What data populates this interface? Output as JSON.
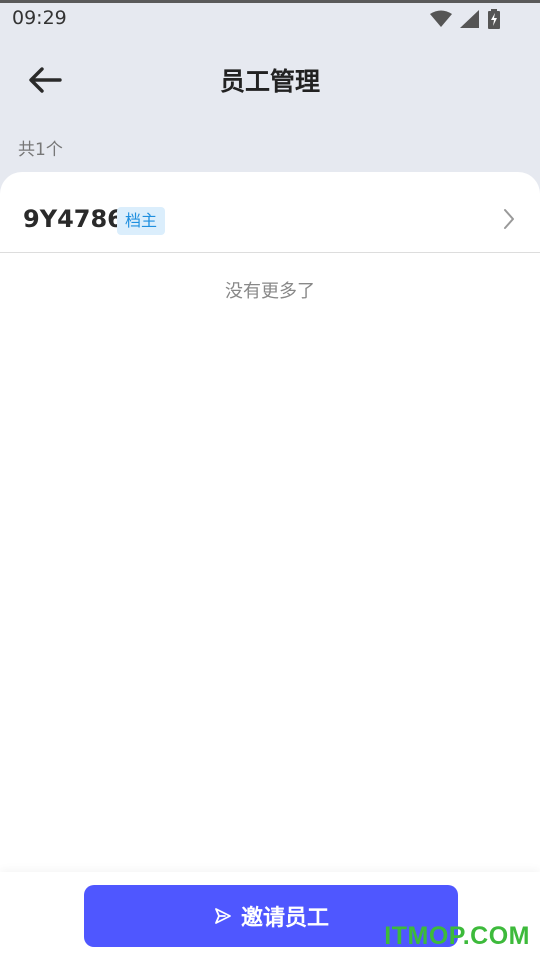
{
  "status_bar": {
    "time": "09:29",
    "icons": [
      "wifi-icon",
      "signal-icon",
      "battery-charging-icon"
    ]
  },
  "header": {
    "title": "员工管理",
    "back_icon": "arrow-left-icon"
  },
  "summary": {
    "count_text": "共1个"
  },
  "employees": [
    {
      "name": "9Y4786",
      "role": "档主"
    }
  ],
  "list_footer": "没有更多了",
  "bottom": {
    "invite_label": "邀请员工",
    "invite_icon": "send-icon"
  },
  "watermark": "ITMOP.COM",
  "colors": {
    "primary": "#4f57ff",
    "badge_bg": "#dbeefc",
    "badge_text": "#1e8fdf",
    "page_bg": "#e6e9f0",
    "watermark": "#3dba3b"
  }
}
